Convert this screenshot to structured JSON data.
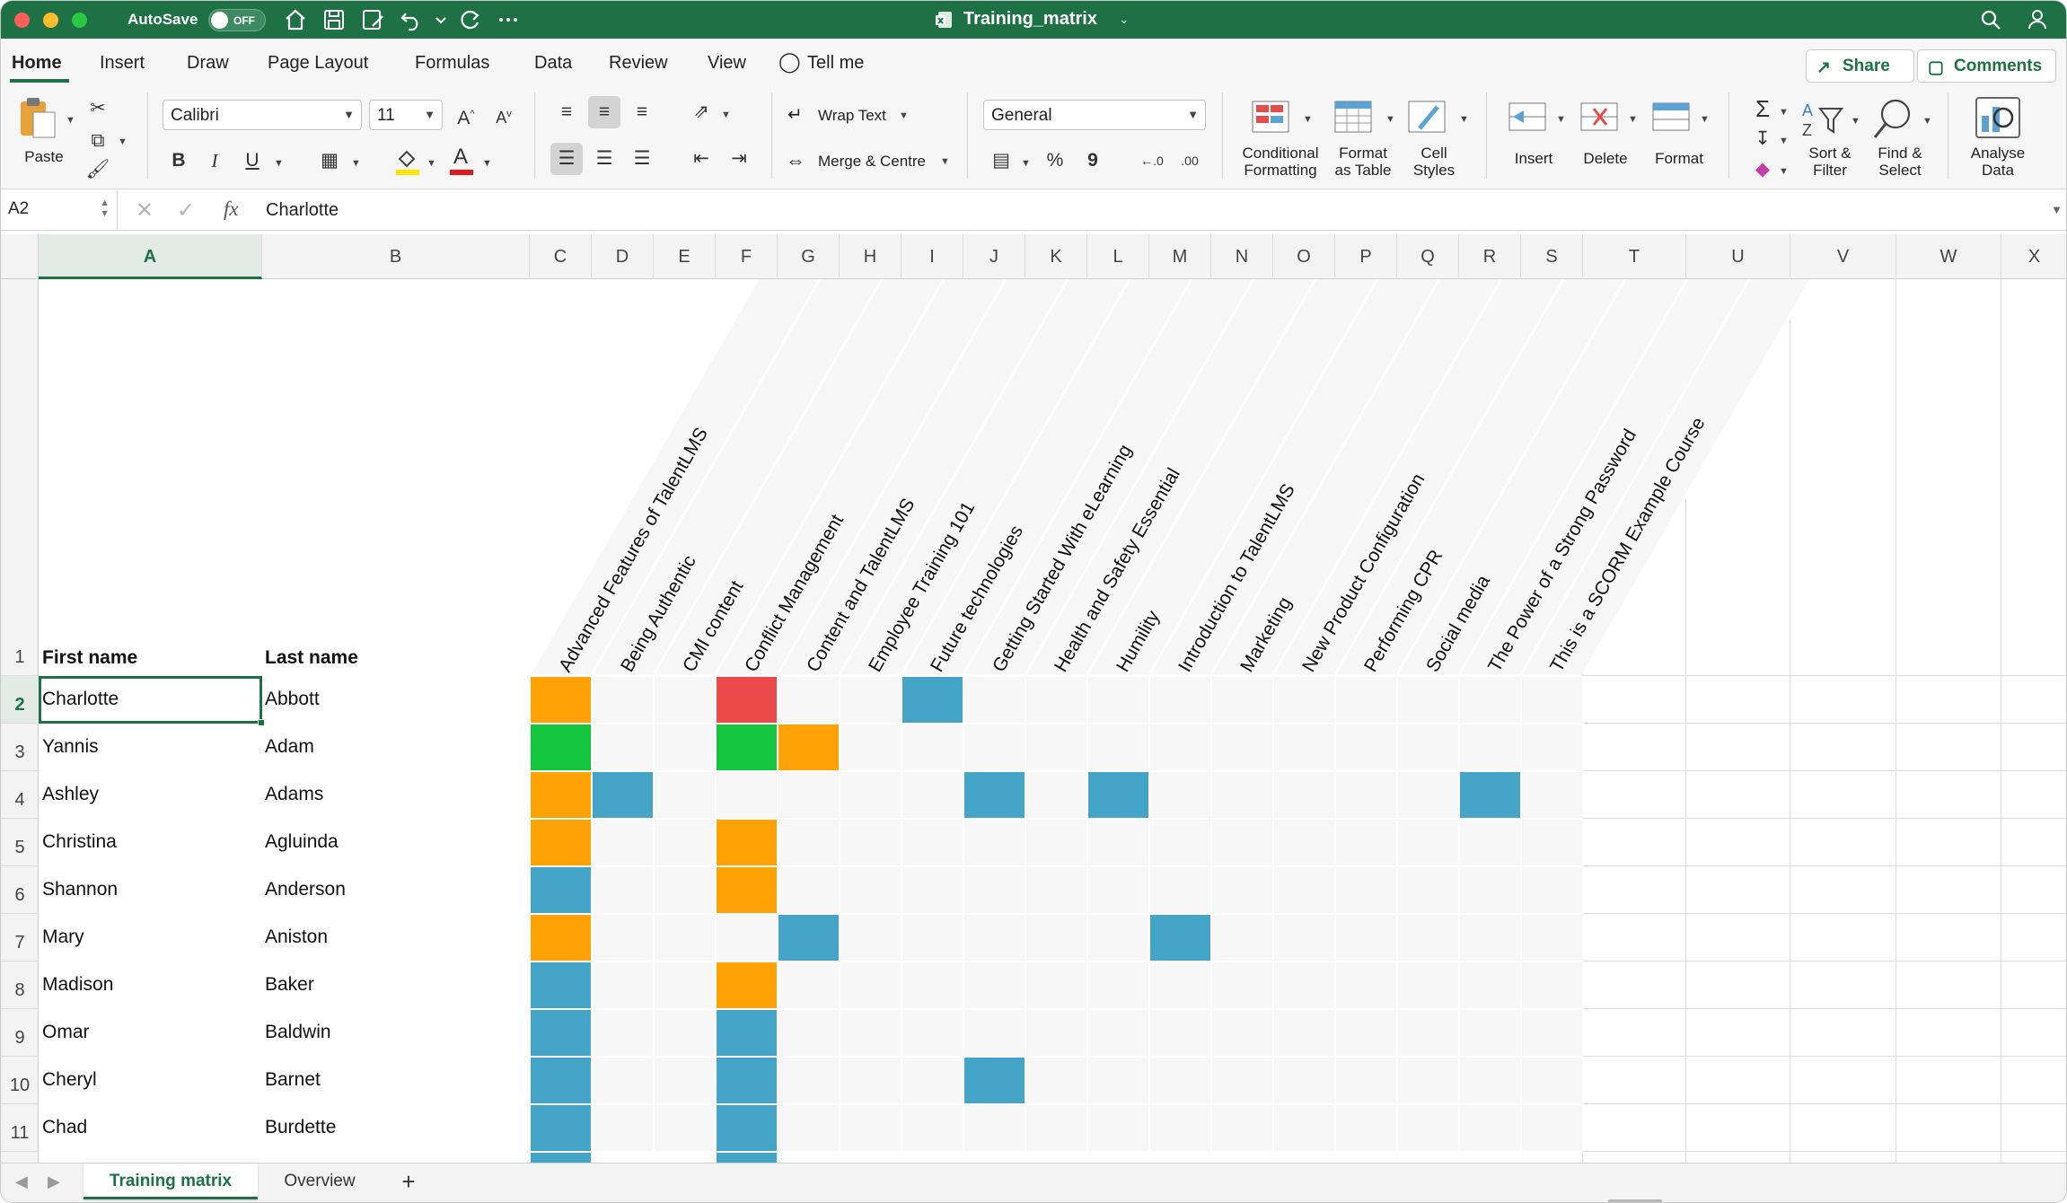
{
  "titlebar": {
    "autosave_label": "AutoSave",
    "autosave_state": "OFF",
    "document_title": "Training_matrix"
  },
  "menu": {
    "tabs": [
      "Home",
      "Insert",
      "Draw",
      "Page Layout",
      "Formulas",
      "Data",
      "Review",
      "View"
    ],
    "tell_me": "Tell me",
    "share": "Share",
    "comments": "Comments"
  },
  "ribbon": {
    "paste": "Paste",
    "font_name": "Calibri",
    "font_size": "11",
    "wrap_text": "Wrap Text",
    "merge_centre": "Merge & Centre",
    "number_format": "General",
    "conditional_formatting": [
      "Conditional",
      "Formatting"
    ],
    "format_as_table": [
      "Format",
      "as Table"
    ],
    "cell_styles": [
      "Cell",
      "Styles"
    ],
    "insert": "Insert",
    "delete": "Delete",
    "format": "Format",
    "sort_filter": [
      "Sort &",
      "Filter"
    ],
    "find_select": [
      "Find &",
      "Select"
    ],
    "analyse_data": [
      "Analyse",
      "Data"
    ],
    "bold": "B",
    "italic": "I",
    "underline": "U",
    "percent": "%",
    "comma": "9"
  },
  "formula_bar": {
    "cell_ref": "A2",
    "fx": "fx",
    "content": "Charlotte"
  },
  "columns": [
    "A",
    "B",
    "C",
    "D",
    "E",
    "F",
    "G",
    "H",
    "I",
    "J",
    "K",
    "L",
    "M",
    "N",
    "O",
    "P",
    "Q",
    "R",
    "S",
    "T",
    "U",
    "V",
    "W",
    "X"
  ],
  "rows": [
    "1",
    "2",
    "3",
    "4",
    "5",
    "6",
    "7",
    "8",
    "9",
    "10",
    "11"
  ],
  "header_row": {
    "first_name": "First name",
    "last_name": "Last name"
  },
  "courses": [
    "Advanced Features of TalentLMS",
    "Being Authentic",
    "CMI content",
    "Conflict Management",
    "Content and TalentLMS",
    "Employee Training 101",
    "Future technologies",
    "Getting Started With eLearning",
    "Health and Safety Essential",
    "Humility",
    "Introduction to TalentLMS",
    "Marketing",
    "New Product Configuration",
    "Performing CPR",
    "Social media",
    "The Power of a Strong Password",
    "This is a SCORM Example Course"
  ],
  "colors": {
    "orange": "#ffa206",
    "red": "#ec4a4a",
    "green": "#13c63d",
    "blue": "#44a5c9",
    "excel_green": "#1e7145"
  },
  "people": [
    {
      "first": "Charlotte",
      "last": "Abbott",
      "status": [
        "orange",
        "",
        "",
        "red",
        "",
        "",
        "blue",
        "",
        "",
        "",
        "",
        "",
        "",
        "",
        "",
        "",
        ""
      ]
    },
    {
      "first": "Yannis",
      "last": "Adam",
      "status": [
        "green",
        "",
        "",
        "green",
        "orange",
        "",
        "",
        "",
        "",
        "",
        "",
        "",
        "",
        "",
        "",
        "",
        ""
      ]
    },
    {
      "first": "Ashley",
      "last": "Adams",
      "status": [
        "orange",
        "blue",
        "",
        "",
        "",
        "",
        "",
        "blue",
        "",
        "blue",
        "",
        "",
        "",
        "",
        "",
        "blue",
        ""
      ]
    },
    {
      "first": "Christina",
      "last": "Agluinda",
      "status": [
        "orange",
        "",
        "",
        "orange",
        "",
        "",
        "",
        "",
        "",
        "",
        "",
        "",
        "",
        "",
        "",
        "",
        ""
      ]
    },
    {
      "first": "Shannon",
      "last": "Anderson",
      "status": [
        "blue",
        "",
        "",
        "orange",
        "",
        "",
        "",
        "",
        "",
        "",
        "",
        "",
        "",
        "",
        "",
        "",
        ""
      ]
    },
    {
      "first": "Mary",
      "last": "Aniston",
      "status": [
        "orange",
        "",
        "",
        "",
        "blue",
        "",
        "",
        "",
        "",
        "",
        "blue",
        "",
        "",
        "",
        "",
        "",
        ""
      ]
    },
    {
      "first": "Madison",
      "last": "Baker",
      "status": [
        "blue",
        "",
        "",
        "orange",
        "",
        "",
        "",
        "",
        "",
        "",
        "",
        "",
        "",
        "",
        "",
        "",
        ""
      ]
    },
    {
      "first": "Omar",
      "last": "Baldwin",
      "status": [
        "blue",
        "",
        "",
        "blue",
        "",
        "",
        "",
        "",
        "",
        "",
        "",
        "",
        "",
        "",
        "",
        "",
        ""
      ]
    },
    {
      "first": "Cheryl",
      "last": "Barnet",
      "status": [
        "blue",
        "",
        "",
        "blue",
        "",
        "",
        "",
        "blue",
        "",
        "",
        "",
        "",
        "",
        "",
        "",
        "",
        ""
      ]
    },
    {
      "first": "Chad",
      "last": "Burdette",
      "status": [
        "blue",
        "",
        "",
        "blue",
        "",
        "",
        "",
        "",
        "",
        "",
        "",
        "",
        "",
        "",
        "",
        "",
        ""
      ]
    }
  ],
  "sheets": {
    "tabs": [
      "Training matrix",
      "Overview"
    ],
    "add": "+"
  }
}
